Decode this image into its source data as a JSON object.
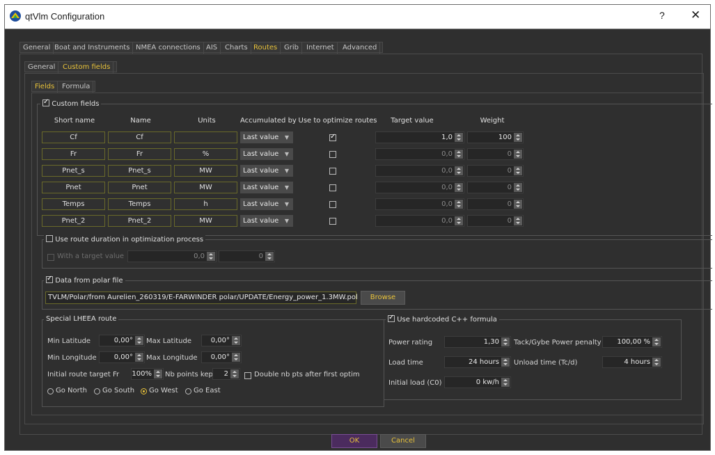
{
  "window": {
    "title": "qtVlm Configuration",
    "help": "?",
    "close": "✕"
  },
  "main_tabs": [
    "General",
    "Boat and Instruments",
    "NMEA connections",
    "AIS",
    "Charts",
    "Routes",
    "Grib",
    "Internet",
    "Advanced"
  ],
  "main_tabs_active": "Routes",
  "sub_tabs": [
    "General",
    "Custom fields"
  ],
  "sub_tabs_active": "Custom fields",
  "inner_tabs": [
    "Fields",
    "Formula"
  ],
  "inner_tabs_active": "Fields",
  "custom_fields": {
    "title": "Custom fields",
    "checked": true,
    "headers": {
      "short_name": "Short name",
      "name": "Name",
      "units": "Units",
      "accumulated": "Accumulated by",
      "optimize": "Use to optimize routes",
      "target": "Target value",
      "weight": "Weight"
    },
    "rows": [
      {
        "short": "Cf",
        "name": "Cf",
        "units": "",
        "accum": "Last value",
        "optimize": true,
        "target": "1,0",
        "weight": "100"
      },
      {
        "short": "Fr",
        "name": "Fr",
        "units": "%",
        "accum": "Last value",
        "optimize": false,
        "target": "0,0",
        "weight": "0"
      },
      {
        "short": "Pnet_s",
        "name": "Pnet_s",
        "units": "MW",
        "accum": "Last value",
        "optimize": false,
        "target": "0,0",
        "weight": "0"
      },
      {
        "short": "Pnet",
        "name": "Pnet",
        "units": "MW",
        "accum": "Last value",
        "optimize": false,
        "target": "0,0",
        "weight": "0"
      },
      {
        "short": "Temps",
        "name": "Temps",
        "units": "h",
        "accum": "Last value",
        "optimize": false,
        "target": "0,0",
        "weight": "0"
      },
      {
        "short": "Pnet_2",
        "name": "Pnet_2",
        "units": "MW",
        "accum": "Last value",
        "optimize": false,
        "target": "0,0",
        "weight": "0"
      }
    ]
  },
  "route_duration": {
    "title": "Use route duration in optimization process",
    "checked": false,
    "with_target_label": "With a target value",
    "target": "0,0",
    "weight": "0"
  },
  "polar": {
    "title": "Data from polar file",
    "checked": true,
    "path": "TVLM/Polar/from Aurelien_260319/E-FARWINDER polar/UPDATE/Energy_power_1.3MW.pol",
    "browse": "Browse"
  },
  "lheea": {
    "title": "Special LHEEA route",
    "min_lat_label": "Min Latitude",
    "min_lat": "0,00°",
    "max_lat_label": "Max Latitude",
    "max_lat": "0,00°",
    "min_lon_label": "Min Longitude",
    "min_lon": "0,00°",
    "max_lon_label": "Max Longitude",
    "max_lon": "0,00°",
    "init_target_label": "Initial route target Fr",
    "init_target": "100%",
    "nb_points_label": "Nb points kept",
    "nb_points": "2",
    "double_label": "Double nb pts after first optim",
    "directions": [
      "Go North",
      "Go South",
      "Go West",
      "Go East"
    ],
    "direction_selected": "Go West"
  },
  "cpp": {
    "title": "Use hardcoded C++ formula",
    "checked": true,
    "power_rating_label": "Power rating",
    "power_rating": "1,30",
    "penalty_label": "Tack/Gybe Power penalty",
    "penalty": "100,00 %",
    "load_time_label": "Load time",
    "load_time": "24 hours",
    "unload_label": "Unload time (Tc/d)",
    "unload": "4 hours",
    "initial_load_label": "Initial load (C0)",
    "initial_load": "0 kw/h"
  },
  "buttons": {
    "ok": "OK",
    "cancel": "Cancel"
  },
  "colors": {
    "accent": "#e8c23a",
    "background": "#2f2f2f",
    "ok_button": "#4b2b5e"
  },
  "icons": {
    "app": "qtvlm-logo-icon"
  }
}
